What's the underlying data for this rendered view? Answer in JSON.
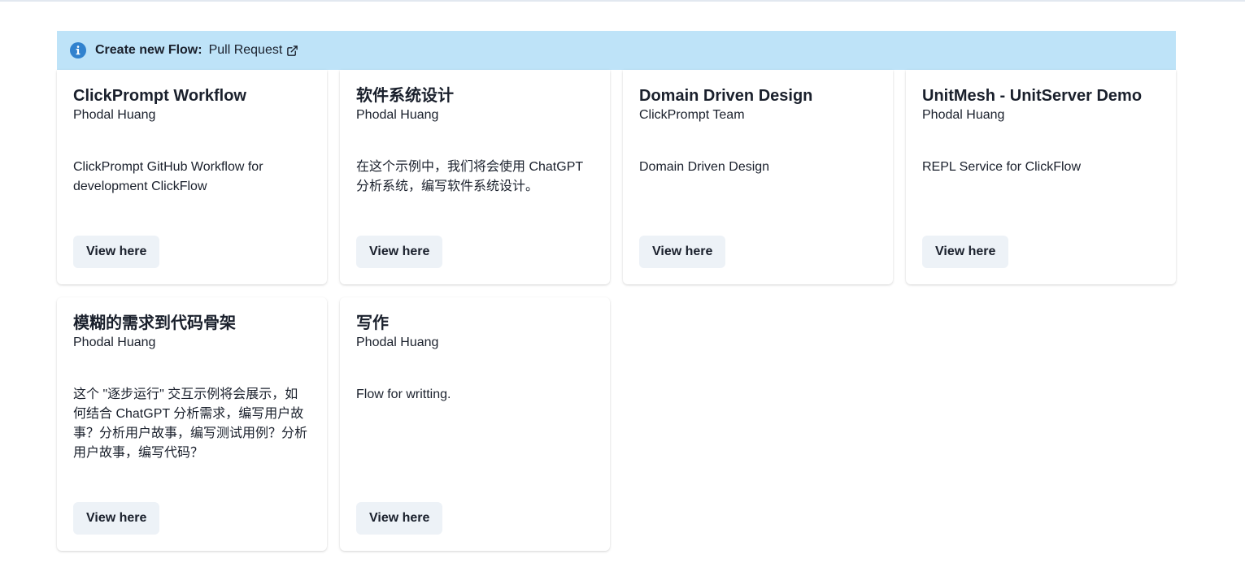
{
  "banner": {
    "title": "Create new Flow:",
    "link_label": "Pull Request"
  },
  "cards": [
    {
      "title": "ClickPrompt Workflow",
      "author": "Phodal Huang",
      "description": "ClickPrompt GitHub Workflow for development ClickFlow",
      "button": "View here"
    },
    {
      "title": "软件系统设计",
      "author": "Phodal Huang",
      "description": "在这个示例中，我们将会使用 ChatGPT 分析系统，编写软件系统设计。",
      "button": "View here"
    },
    {
      "title": "Domain Driven Design",
      "author": "ClickPrompt Team",
      "description": "Domain Driven Design",
      "button": "View here"
    },
    {
      "title": "UnitMesh - UnitServer Demo",
      "author": "Phodal Huang",
      "description": "REPL Service for ClickFlow",
      "button": "View here"
    },
    {
      "title": "模糊的需求到代码骨架",
      "author": "Phodal Huang",
      "description": "这个 \"逐步运行\" 交互示例将会展示，如何结合 ChatGPT 分析需求，编写用户故事？分析用户故事，编写测试用例？分析用户故事，编写代码？",
      "button": "View here"
    },
    {
      "title": "写作",
      "author": "Phodal Huang",
      "description": "Flow for writting.",
      "button": "View here"
    }
  ],
  "colors": {
    "banner_bg": "#bee3f8",
    "info_icon": "#3182ce",
    "button_bg": "#edf2f7"
  }
}
